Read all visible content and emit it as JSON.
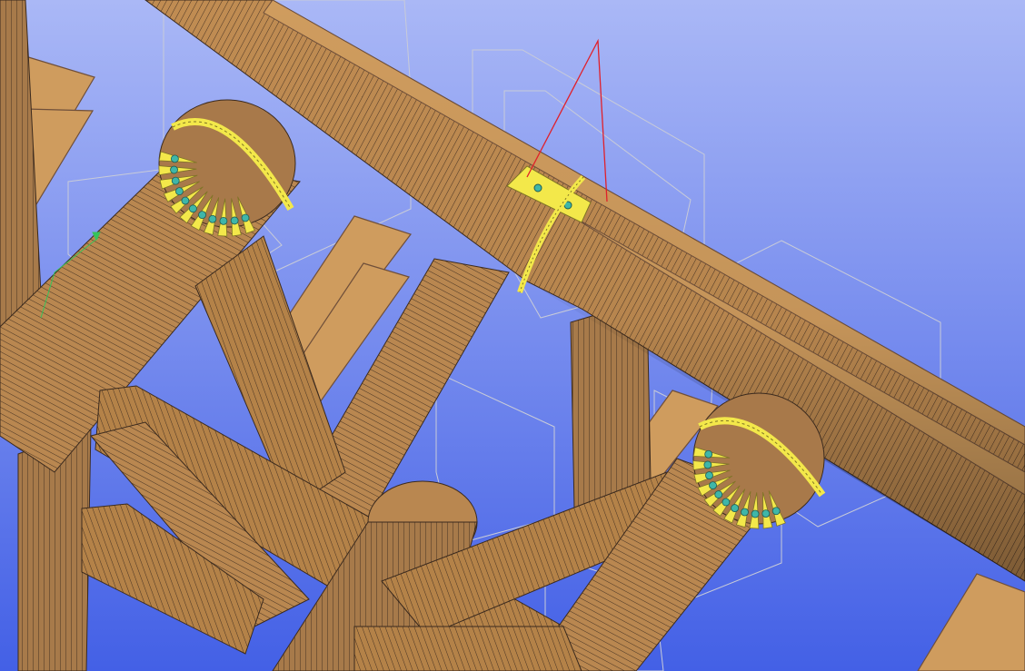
{
  "scene": {
    "kind": "3d-cad-viewport",
    "subject": "timber-truss-connection",
    "colors": {
      "bg_top": "#aab8f6",
      "bg_bottom": "#4360e6",
      "wood_light": "#cf9c5e",
      "wood_mid": "#a87a46",
      "wood_dark": "#5a4030",
      "wood_shadow": "#6f4f3a",
      "steel_plate": "#f3e84a",
      "steel_plate_edge": "#7f7426",
      "bolt": "#3fb6a8",
      "wireframe": "#c8cbd8",
      "selection_line": "#e0202a",
      "axis_triad": "#36c25a"
    }
  }
}
